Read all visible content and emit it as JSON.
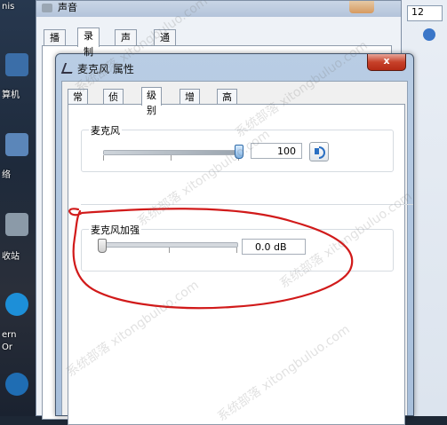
{
  "desktop": {
    "labels": [
      "nis",
      "算机",
      "络",
      "收站",
      "ern",
      "Or"
    ]
  },
  "background_window": {
    "title": "声音",
    "tabs": [
      "播放",
      "录制",
      "声音",
      "通信"
    ],
    "active_tab": 1,
    "right_window_text": "12"
  },
  "dialog": {
    "title": "麦克风 属性",
    "close_label": "x",
    "tabs": [
      "常规",
      "侦听",
      "级别",
      "增强",
      "高级"
    ],
    "active_tab": 2,
    "level": {
      "label": "麦克风",
      "value_text": "100",
      "value": 1.0
    },
    "boost": {
      "label": "麦克风加强",
      "value_text": "0.0 dB",
      "value": 0.0
    }
  },
  "annotation": {
    "color": "#d11a1a"
  },
  "watermark": "系统部落 xitongbuluo.com"
}
